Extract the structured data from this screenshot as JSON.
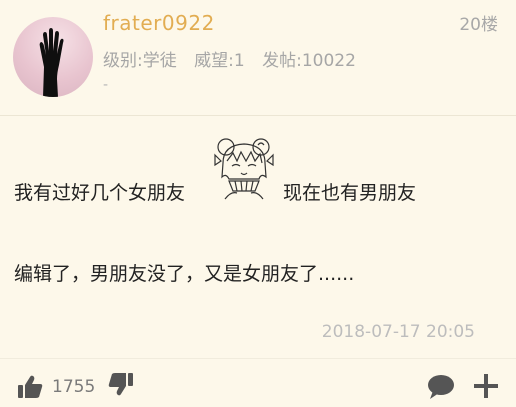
{
  "post": {
    "author": {
      "username": "frater0922",
      "level_label": "级别:学徒",
      "prestige_label": "威望:1",
      "posts_label": "发帖:10022",
      "signature": "-"
    },
    "floor": "20楼",
    "content": {
      "line1_before": "我有过好几个女朋友",
      "line1_after": "现在也有男朋友",
      "line2": "编辑了，男朋友没了，又是女朋友了......"
    },
    "timestamp": "2018-07-17 20:05",
    "likes": "1755",
    "icons": {
      "like": "thumbs-up-icon",
      "dislike": "thumbs-down-icon",
      "reply": "comment-bubble-icon",
      "more": "plus-icon",
      "emoticon": "anime-girl-emoticon"
    },
    "colors": {
      "username": "#e2ad52",
      "background": "#fdf8ea",
      "icon": "#555555"
    }
  }
}
